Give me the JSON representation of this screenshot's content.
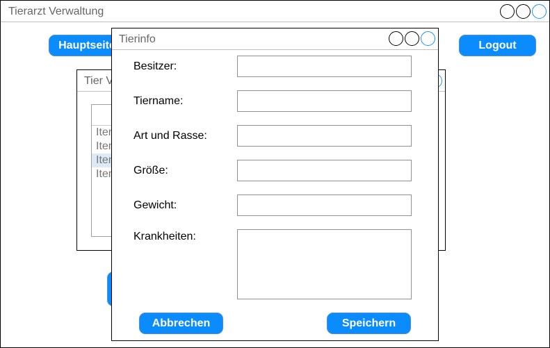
{
  "main_window": {
    "title": "Tierarzt Verwaltung",
    "buttons": {
      "hauptseite": "Hauptseite",
      "logout": "Logout"
    }
  },
  "back_window": {
    "title": "Tier Verwaltung",
    "list_items": [
      "Item",
      "Item",
      "Item",
      "Item"
    ],
    "selected_index": 2
  },
  "tierinfo": {
    "title": "Tierinfo",
    "fields": {
      "besitzer": {
        "label": "Besitzer:",
        "value": ""
      },
      "tiername": {
        "label": "Tiername:",
        "value": ""
      },
      "art_rasse": {
        "label": "Art und Rasse:",
        "value": ""
      },
      "groesse": {
        "label": "Größe:",
        "value": ""
      },
      "gewicht": {
        "label": "Gewicht:",
        "value": ""
      },
      "krankheiten": {
        "label": "Krankheiten:",
        "value": ""
      }
    },
    "buttons": {
      "abbrechen": "Abbrechen",
      "speichern": "Speichern"
    }
  },
  "colors": {
    "accent": "#0a8cff",
    "control_accent": "#1e90ff",
    "selection": "#dceaf7",
    "title_text": "#666666"
  }
}
